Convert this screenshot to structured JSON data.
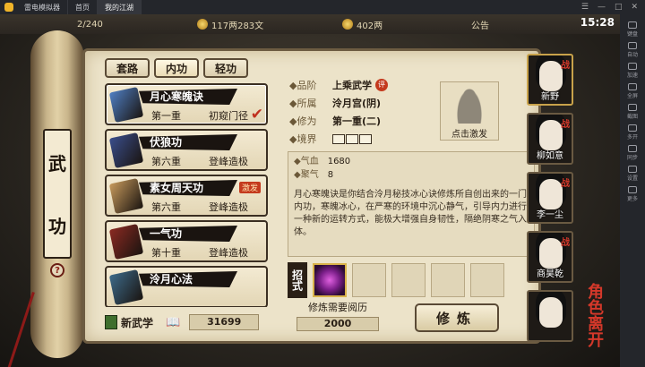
{
  "emulator": {
    "app_name": "雷电模拟器",
    "tabs": [
      "首页",
      "我的江湖"
    ],
    "sidebar": [
      "键盘",
      "自动",
      "加速",
      "全屏",
      "截图",
      "多开",
      "同步",
      "设置",
      "更多"
    ]
  },
  "hud": {
    "energy": "2/240",
    "money": "117两283文",
    "silver": "402两",
    "notice": "公告",
    "time": "15:28"
  },
  "scroll": {
    "title_1": "武",
    "title_2": "功",
    "help": "?"
  },
  "tabs": [
    "套路",
    "内功",
    "轻功"
  ],
  "skills": [
    {
      "name": "月心寒魄诀",
      "level": "第一重",
      "stage": "初窥门径",
      "check": "✔",
      "badge": "",
      "book_color": "#4f7fc4"
    },
    {
      "name": "伏狼功",
      "level": "第六重",
      "stage": "登峰造极",
      "check": "",
      "badge": "",
      "book_color": "#3a4e8c"
    },
    {
      "name": "素女周天功",
      "level": "第六重",
      "stage": "登峰造极",
      "check": "",
      "badge": "激发",
      "book_color": "#c79a5c"
    },
    {
      "name": "一气功",
      "level": "第十重",
      "stage": "登峰造极",
      "check": "",
      "badge": "",
      "book_color": "#8b2a22"
    },
    {
      "name": "泠月心法",
      "level": "",
      "stage": "",
      "check": "",
      "badge": "",
      "book_color": "#3d6a8a"
    }
  ],
  "detail": {
    "grade_key": "◆品阶",
    "grade_val": "上乘武学",
    "grade_eval": "评",
    "sect_key": "◆所属",
    "sect_val": "泠月宫(阴)",
    "cultivate_key": "◆修为",
    "cultivate_val": "第一重(二)",
    "realm_key": "◆境界",
    "figure_label": "点击激发",
    "stat1_key": "◆气血",
    "stat1_val": "1680",
    "stat2_key": "◆聚气",
    "stat2_val": "8",
    "description": "月心寒魄诀是你结合泠月秘技冰心诀修炼所自创出来的一门内功，寒魄冰心，在严寒的环境中沉心静气，引导内力进行一种新的运转方式，能极大增强自身韧性，隔绝阴寒之气入体。",
    "moves_label": "招式"
  },
  "bottom": {
    "new_skill": "新武学",
    "exp": "31699",
    "cost_label": "修炼需要阅历",
    "cost_value": "2000",
    "train": "修炼"
  },
  "characters": [
    {
      "name": "新野",
      "war": "战"
    },
    {
      "name": "柳如意",
      "war": "战"
    },
    {
      "name": "李一尘",
      "war": "战"
    },
    {
      "name": "商昊乾",
      "war": "战"
    },
    {
      "name": "",
      "war": ""
    }
  ],
  "leave": "角色离开"
}
